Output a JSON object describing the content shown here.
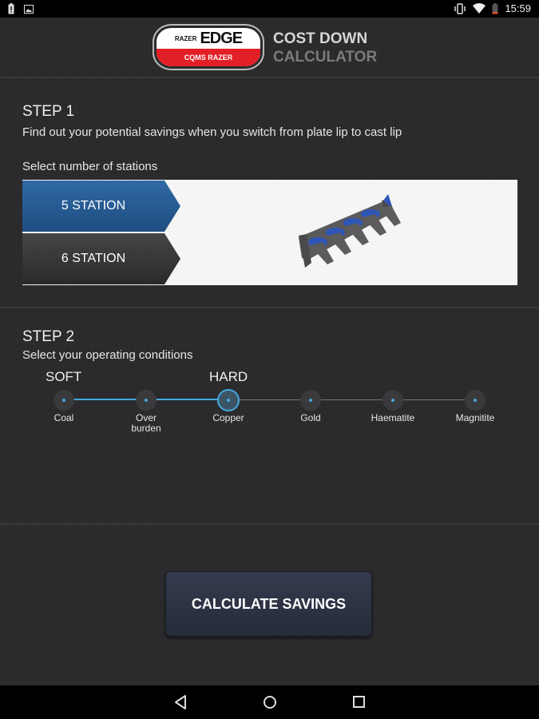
{
  "status_bar": {
    "left_icons": [
      "alert-battery-icon",
      "image-icon"
    ],
    "right_icons": [
      "vibrate-icon",
      "wifi-icon",
      "battery-icon"
    ],
    "time": "15:59"
  },
  "header": {
    "logo": {
      "top_small": "RAZER",
      "top_large": "EDGE",
      "bottom": "CQMS RAZER"
    },
    "title_line1": "COST DOWN",
    "title_line2": "CALCULATOR"
  },
  "step1": {
    "title": "STEP 1",
    "description": "Find out your potential savings when you switch from plate lip to cast lip",
    "prompt": "Select number of stations",
    "options": [
      {
        "label": "5 STATION",
        "selected": true
      },
      {
        "label": "6 STATION",
        "selected": false
      }
    ],
    "image_alt": "5-station cast lip with blue shrouds"
  },
  "step2": {
    "title": "STEP 2",
    "description": "Select your operating conditions",
    "range_start_label": "SOFT",
    "range_end_label": "HARD",
    "stops": [
      {
        "label": "Coal"
      },
      {
        "label": "Over burden"
      },
      {
        "label": "Copper"
      },
      {
        "label": "Gold"
      },
      {
        "label": "Haematite"
      },
      {
        "label": "Magnitite"
      }
    ],
    "selected_index": 2
  },
  "actions": {
    "calculate_label": "CALCULATE SAVINGS"
  },
  "nav_bar": {
    "buttons": [
      "back",
      "home",
      "recents"
    ]
  },
  "colors": {
    "accent_blue": "#43a9dc",
    "selected_station": "#2a5f98",
    "logo_red": "#e21f26"
  }
}
